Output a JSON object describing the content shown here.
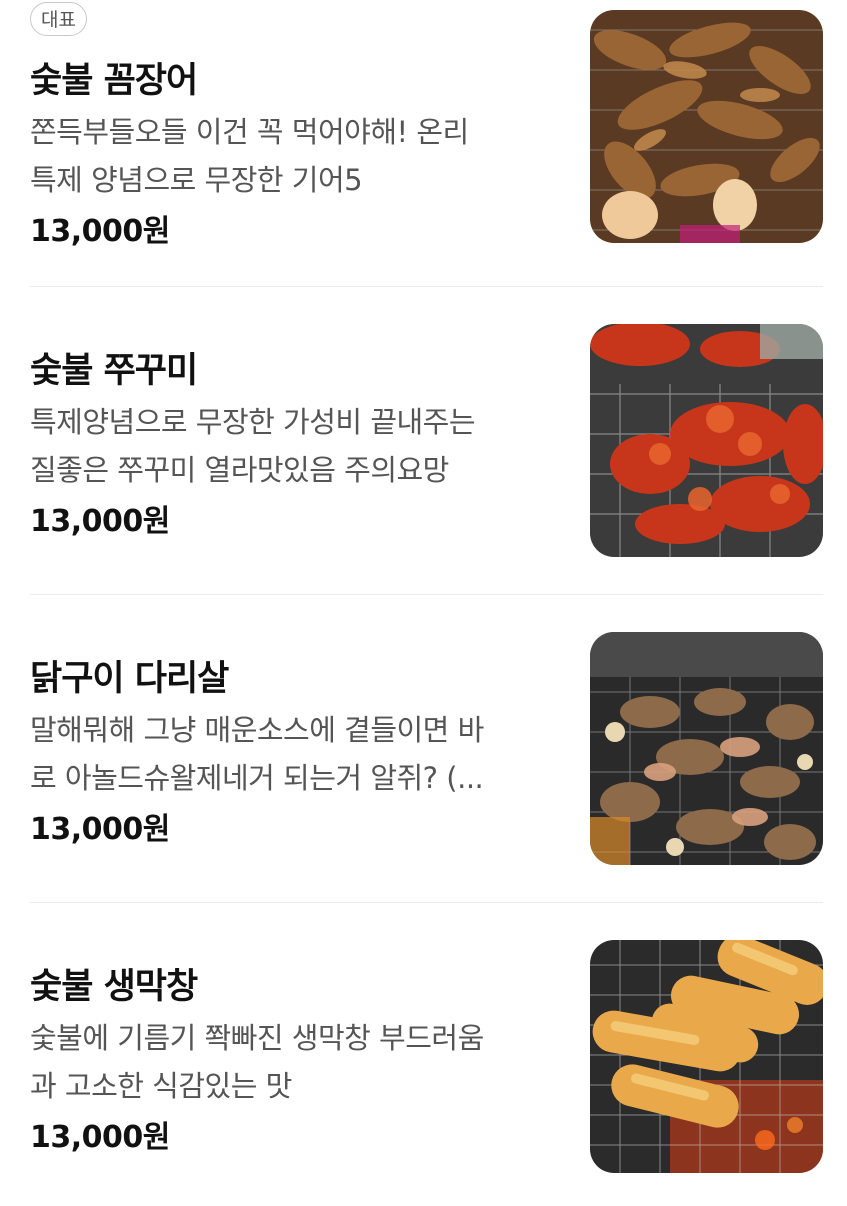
{
  "menu": {
    "items": [
      {
        "badge": "대표",
        "name": "숯불 꼼장어",
        "desc_lines": [
          "쫀득부들오들 이건 꼭 먹어야해! 온리",
          "특제 양념으로 무장한 기어5"
        ],
        "price": "13,000원",
        "photo": "grilled-hagfish-photo"
      },
      {
        "badge": "",
        "name": "숯불 쭈꾸미",
        "desc_lines": [
          "특제양념으로 무장한 가성비 끝내주는",
          "질좋은 쭈꾸미 열라맛있음 주의요망"
        ],
        "price": "13,000원",
        "photo": "grilled-webfoot-octopus-photo"
      },
      {
        "badge": "",
        "name": "닭구이 다리살",
        "desc_lines": [
          "말해뭐해 그냥 매운소스에 곁들이면 바",
          "로 아놀드슈왈제네거 되는거 알쥐? (..."
        ],
        "price": "13,000원",
        "photo": "grilled-chicken-leg-photo"
      },
      {
        "badge": "",
        "name": "숯불 생막창",
        "desc_lines": [
          "숯불에 기름기 쫙빠진 생막창 부드러움",
          "과 고소한 식감있는 맛"
        ],
        "price": "13,000원",
        "photo": "grilled-pork-intestine-photo"
      }
    ]
  },
  "colors": {
    "text_primary": "#111111",
    "text_secondary": "#555555",
    "divider": "#ececec",
    "badge_border": "#c9c9c9"
  }
}
